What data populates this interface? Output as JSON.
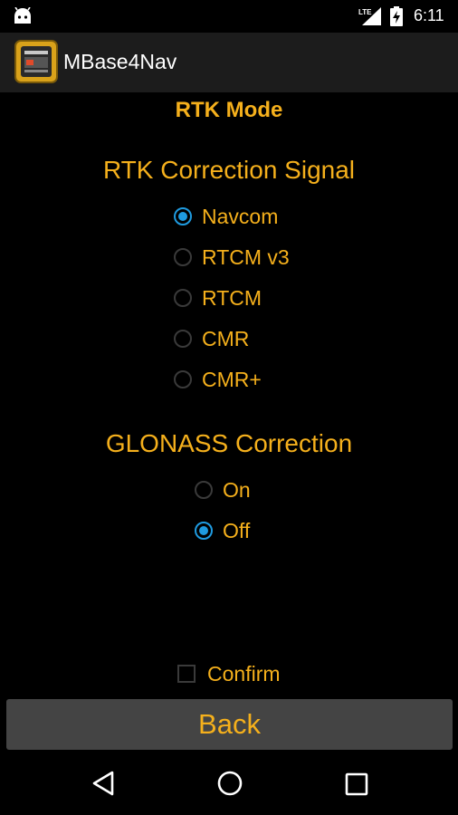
{
  "status_bar": {
    "time": "6:11",
    "network": "LTE",
    "icons": [
      "android-icon",
      "lte-signal-icon",
      "battery-charging-icon"
    ]
  },
  "action_bar": {
    "app_title": "MBase4Nav",
    "app_icon": "mbase-app-icon"
  },
  "page": {
    "title": "RTK Mode",
    "correction_signal": {
      "title": "RTK Correction Signal",
      "options": [
        {
          "label": "Navcom",
          "checked": true
        },
        {
          "label": "RTCM v3",
          "checked": false
        },
        {
          "label": "RTCM",
          "checked": false
        },
        {
          "label": "CMR",
          "checked": false
        },
        {
          "label": "CMR+",
          "checked": false
        }
      ]
    },
    "glonass": {
      "title": "GLONASS Correction",
      "options": [
        {
          "label": "On",
          "checked": false
        },
        {
          "label": "Off",
          "checked": true
        }
      ]
    },
    "confirm": {
      "label": "Confirm",
      "checked": false
    },
    "back_label": "Back"
  },
  "nav_bar": {
    "icons": [
      "back-triangle-icon",
      "home-circle-icon",
      "recents-square-icon"
    ]
  },
  "colors": {
    "accent_text": "#f5b01c",
    "radio_selected": "#1f9be0",
    "background": "#000000",
    "action_bar": "#1c1c1c",
    "button": "#444444"
  }
}
